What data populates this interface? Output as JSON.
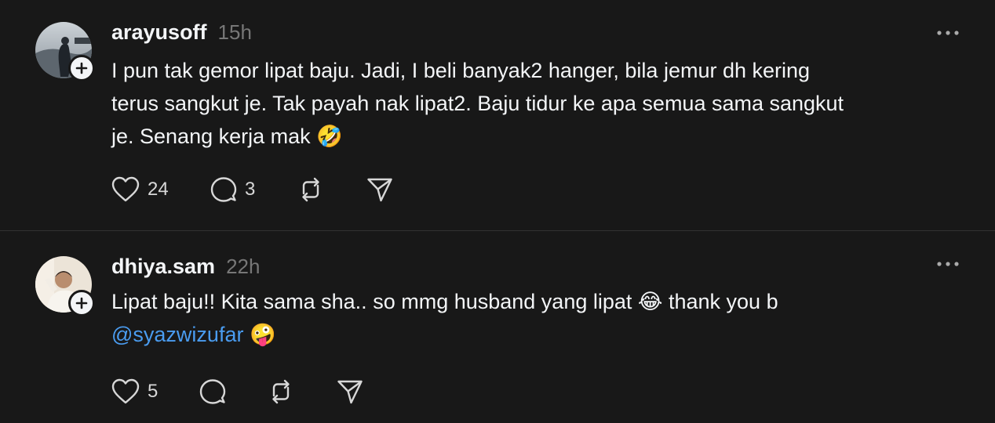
{
  "posts": [
    {
      "username": "arayusoff",
      "timestamp": "15h",
      "text_line1": "I pun tak gemor lipat baju. Jadi, I beli banyak2 hanger, bila jemur dh kering",
      "text_line2": "terus sangkut je. Tak payah nak lipat2. Baju tidur ke apa semua sama sangkut",
      "text_line3": "je. Senang kerja mak",
      "emoji": "🤣",
      "likes": "24",
      "replies": "3"
    },
    {
      "username": "dhiya.sam",
      "timestamp": "22h",
      "text_line1_a": "Lipat baju!! Kita sama sha.. so mmg husband yang lipat",
      "emoji_1": "😂",
      "text_line1_b": "thank you b",
      "mention": "@syazwizufar",
      "emoji_2": "🤪",
      "likes": "5"
    }
  ],
  "icons": {
    "more": "more-horizontal-icon",
    "like": "heart-icon",
    "reply": "comment-icon",
    "repost": "repost-icon",
    "share": "share-send-icon",
    "follow": "plus-icon"
  },
  "colors": {
    "background": "#181818",
    "text": "#f3f5f7",
    "muted": "#777777",
    "mention": "#4a9cf0",
    "divider": "#323232"
  }
}
